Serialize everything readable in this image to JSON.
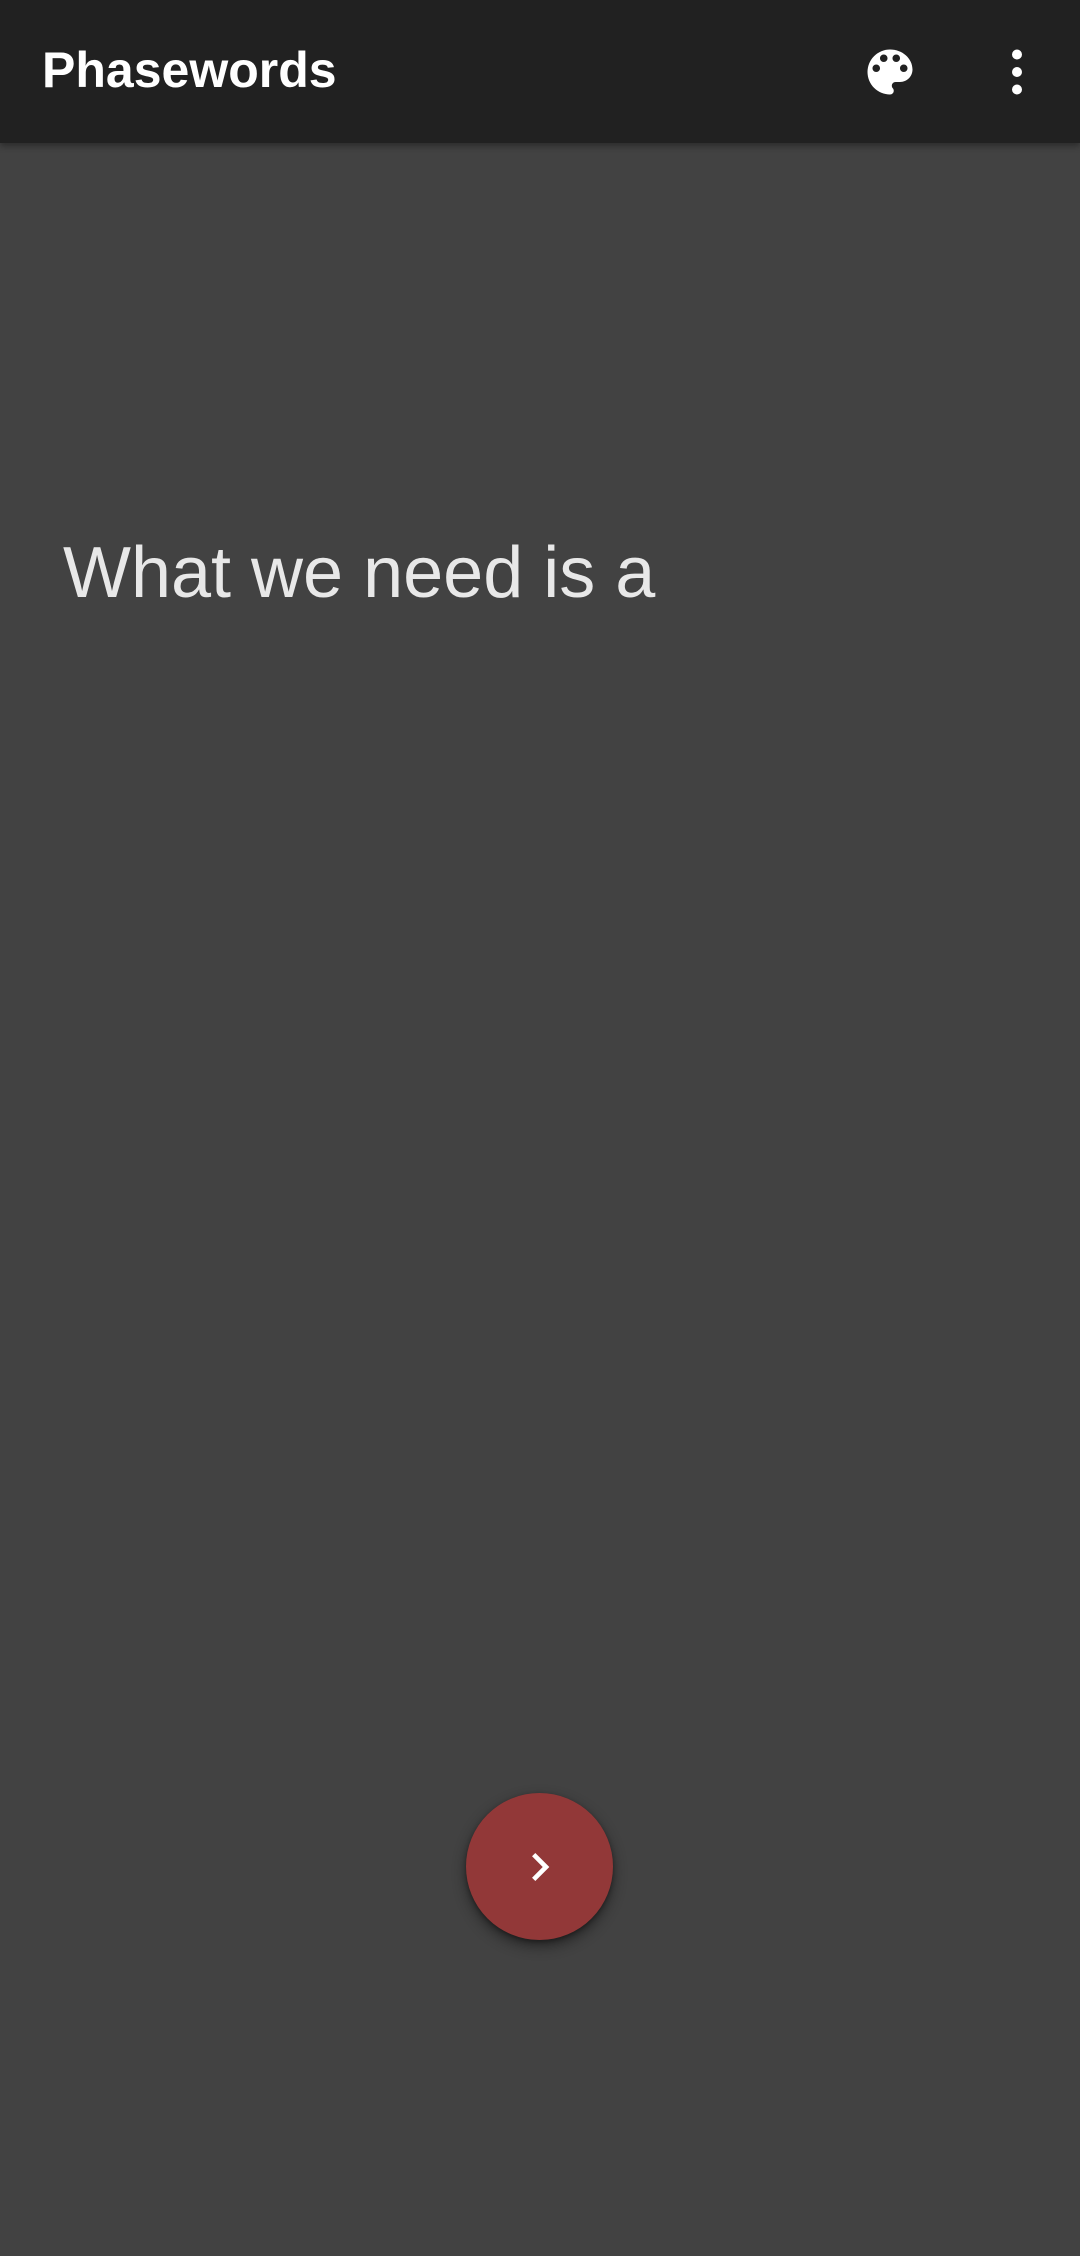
{
  "app": {
    "title": "Phasewords"
  },
  "toolbar": {
    "actions": [
      {
        "icon": "palette-icon"
      },
      {
        "icon": "more-vert-icon"
      }
    ]
  },
  "main": {
    "phrase": "What we need is a"
  },
  "fab": {
    "icon": "chevron-right-icon"
  },
  "colors": {
    "toolbar": "#212121",
    "background": "#424242",
    "accent": "#923838",
    "text": "#e8e8e8"
  }
}
